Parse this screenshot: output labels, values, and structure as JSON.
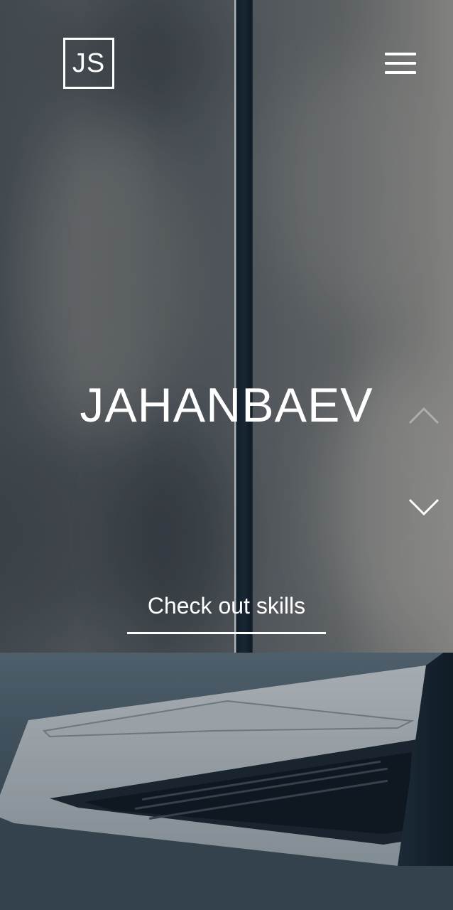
{
  "header": {
    "logo_text": "JS",
    "menu_icon": "hamburger-menu-icon"
  },
  "hero": {
    "title": "JAHANBAEV",
    "cta_label": "Check out skills",
    "prev_icon": "chevron-up-icon",
    "next_icon": "chevron-down-icon"
  },
  "colors": {
    "text": "#ffffff"
  }
}
